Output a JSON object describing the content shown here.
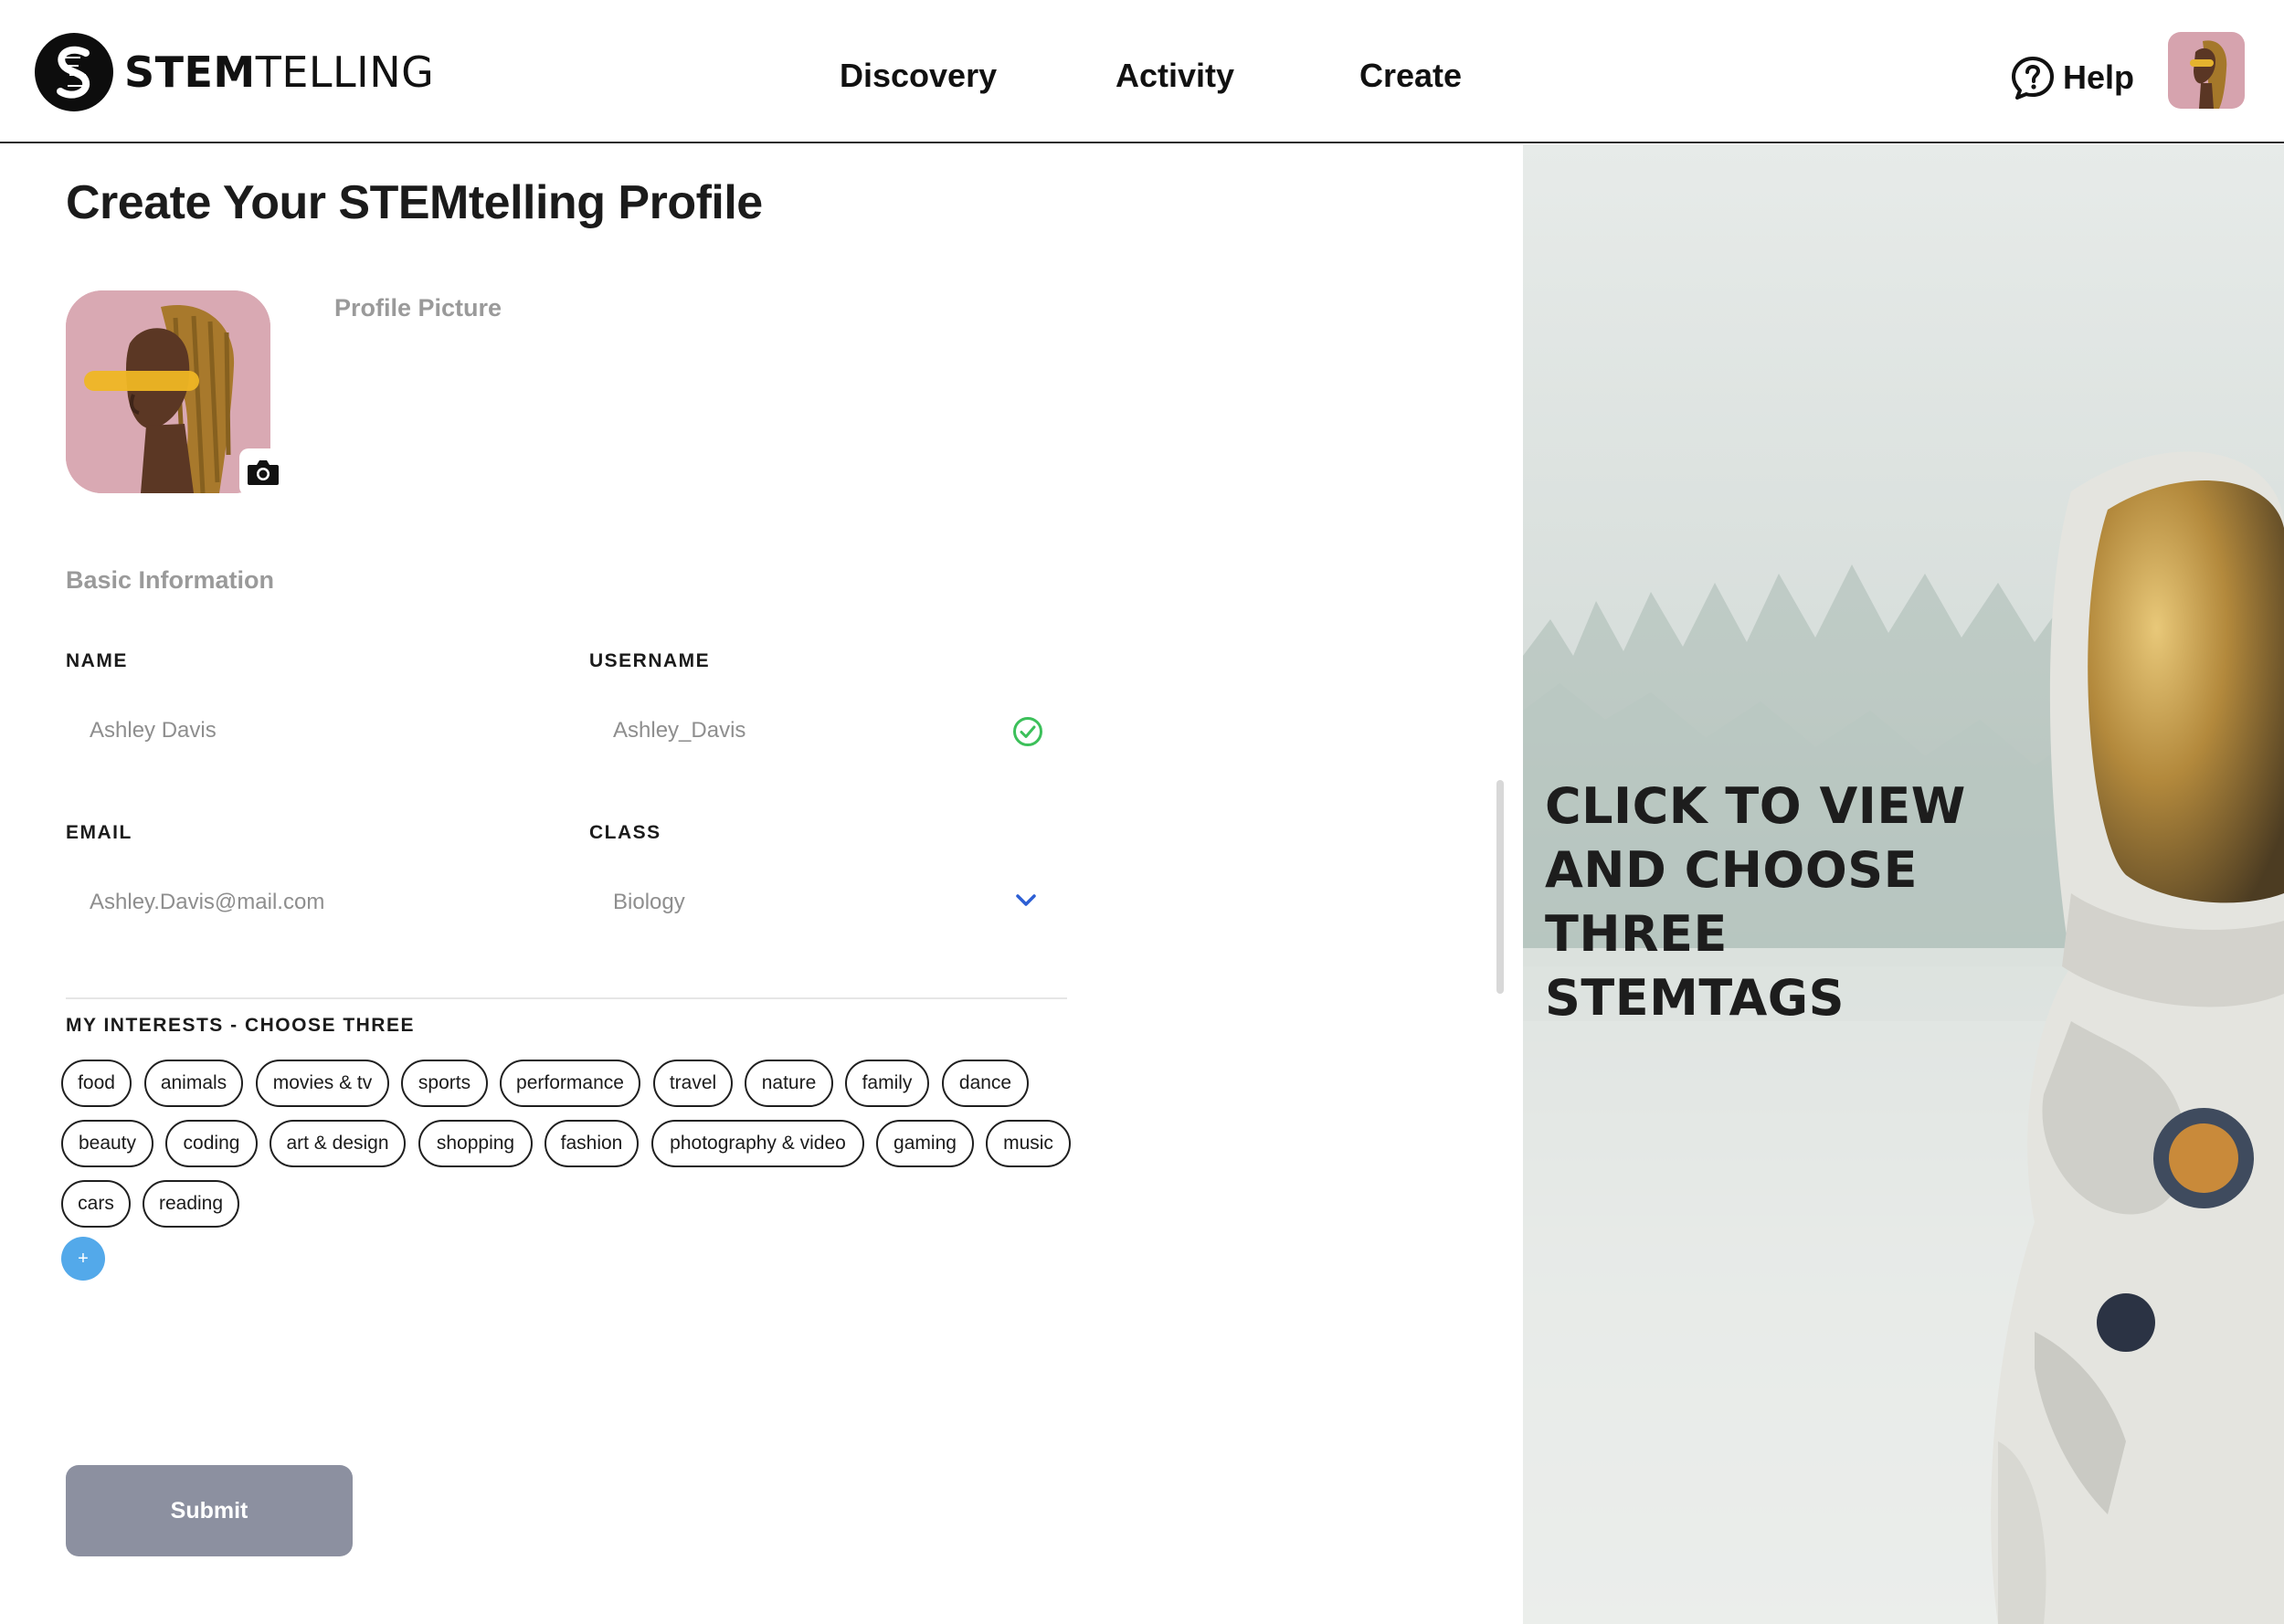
{
  "header": {
    "brand": {
      "bold": "STEM",
      "light": "TELLING"
    },
    "nav": [
      {
        "label": "Discovery"
      },
      {
        "label": "Activity"
      },
      {
        "label": "Create"
      }
    ],
    "help_label": "Help"
  },
  "form": {
    "title": "Create Your STEMtelling Profile",
    "profile_picture_label": "Profile Picture",
    "basic_info_label": "Basic Information",
    "fields": {
      "name": {
        "label": "NAME",
        "value": "Ashley Davis"
      },
      "username": {
        "label": "USERNAME",
        "value": "Ashley_Davis",
        "status": "valid"
      },
      "email": {
        "label": "EMAIL",
        "value": "Ashley.Davis@mail.com"
      },
      "class": {
        "label": "CLASS",
        "value": "Biology"
      }
    },
    "interests_label": "MY INTERESTS - CHOOSE THREE",
    "interests": [
      "food",
      "animals",
      "movies & tv",
      "sports",
      "performance",
      "travel",
      "nature",
      "family",
      "dance",
      "beauty",
      "coding",
      "art & design",
      "shopping",
      "fashion",
      "photography & video",
      "gaming",
      "music",
      "cars",
      "reading"
    ],
    "add_label": "+",
    "submit_label": "Submit"
  },
  "hero": {
    "text": "CLICK TO VIEW AND CHOOSE THREE STEMTAGS"
  },
  "colors": {
    "accent_blue": "#53a9ea",
    "submit_gray": "#8c90a0",
    "valid_green": "#3cc05a",
    "chevron_blue": "#2d5fd4"
  }
}
